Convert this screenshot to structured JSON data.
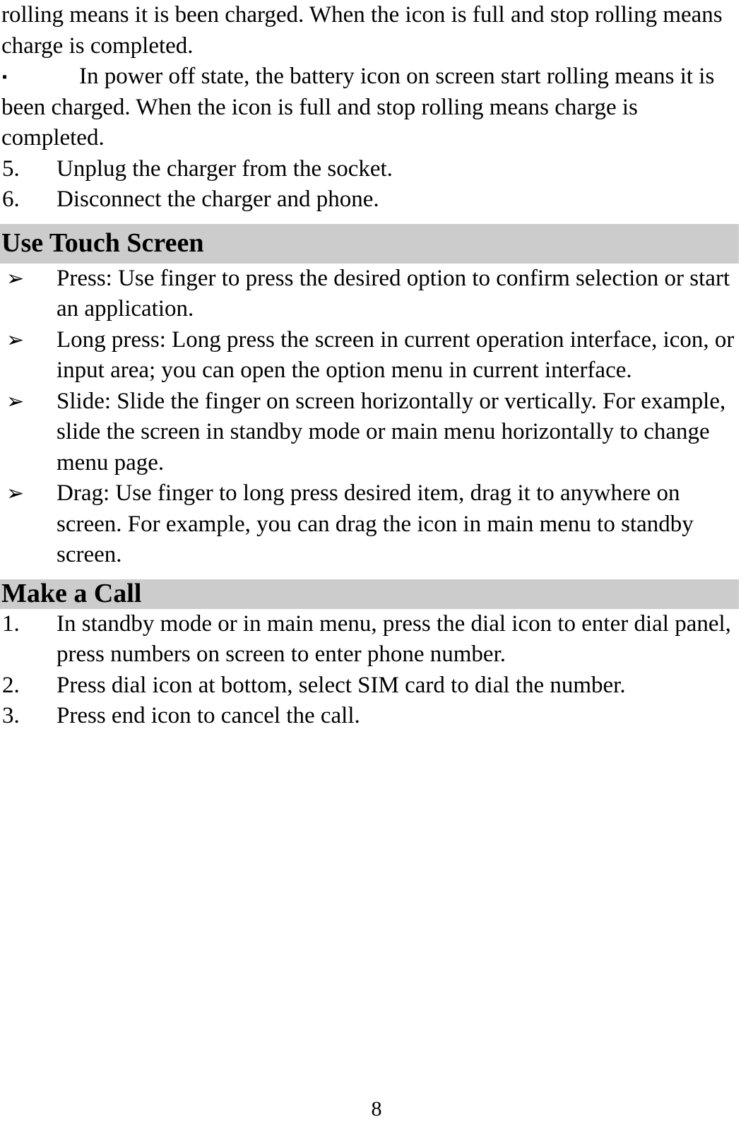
{
  "page": {
    "number": "8",
    "background_color": "#ffffff",
    "text_color": "#000000",
    "heading_band_color": "#cccccc"
  },
  "top_paragraph": {
    "text": "rolling means it is been charged. When the icon is full and stop rolling means charge is completed."
  },
  "square_bullet": {
    "marker": "▪",
    "text": "In power off state, the battery icon on screen start rolling means it is been charged. When the icon is full and stop rolling means charge is completed."
  },
  "charger_steps": [
    {
      "marker": "5.",
      "text": "Unplug the charger from the socket."
    },
    {
      "marker": "6.",
      "text": "Disconnect the charger and phone."
    }
  ],
  "touch_screen_section": {
    "heading": "Use Touch Screen",
    "items": [
      {
        "marker": "➢",
        "text": "Press: Use finger to press the desired option to confirm selection or start an application."
      },
      {
        "marker": "➢",
        "text": "Long press: Long press the screen in current operation interface, icon, or input area; you can open the option menu in current interface."
      },
      {
        "marker": "➢",
        "text": "Slide: Slide the finger on screen horizontally or vertically. For example, slide the screen in standby mode or main menu horizontally to change menu page."
      },
      {
        "marker": "➢",
        "text": "Drag: Use finger to long press desired item, drag it to anywhere on screen. For example, you can drag the icon in main menu to standby screen."
      }
    ]
  },
  "make_a_call_section": {
    "heading": "Make a Call",
    "items": [
      {
        "marker": "1.",
        "text": "In standby mode or in main menu, press the dial icon to enter dial panel, press numbers on screen to enter phone number."
      },
      {
        "marker": "2.",
        "text": "Press dial icon at bottom, select SIM card to dial the number."
      },
      {
        "marker": "3.",
        "text": "Press end icon to cancel the call."
      }
    ]
  }
}
